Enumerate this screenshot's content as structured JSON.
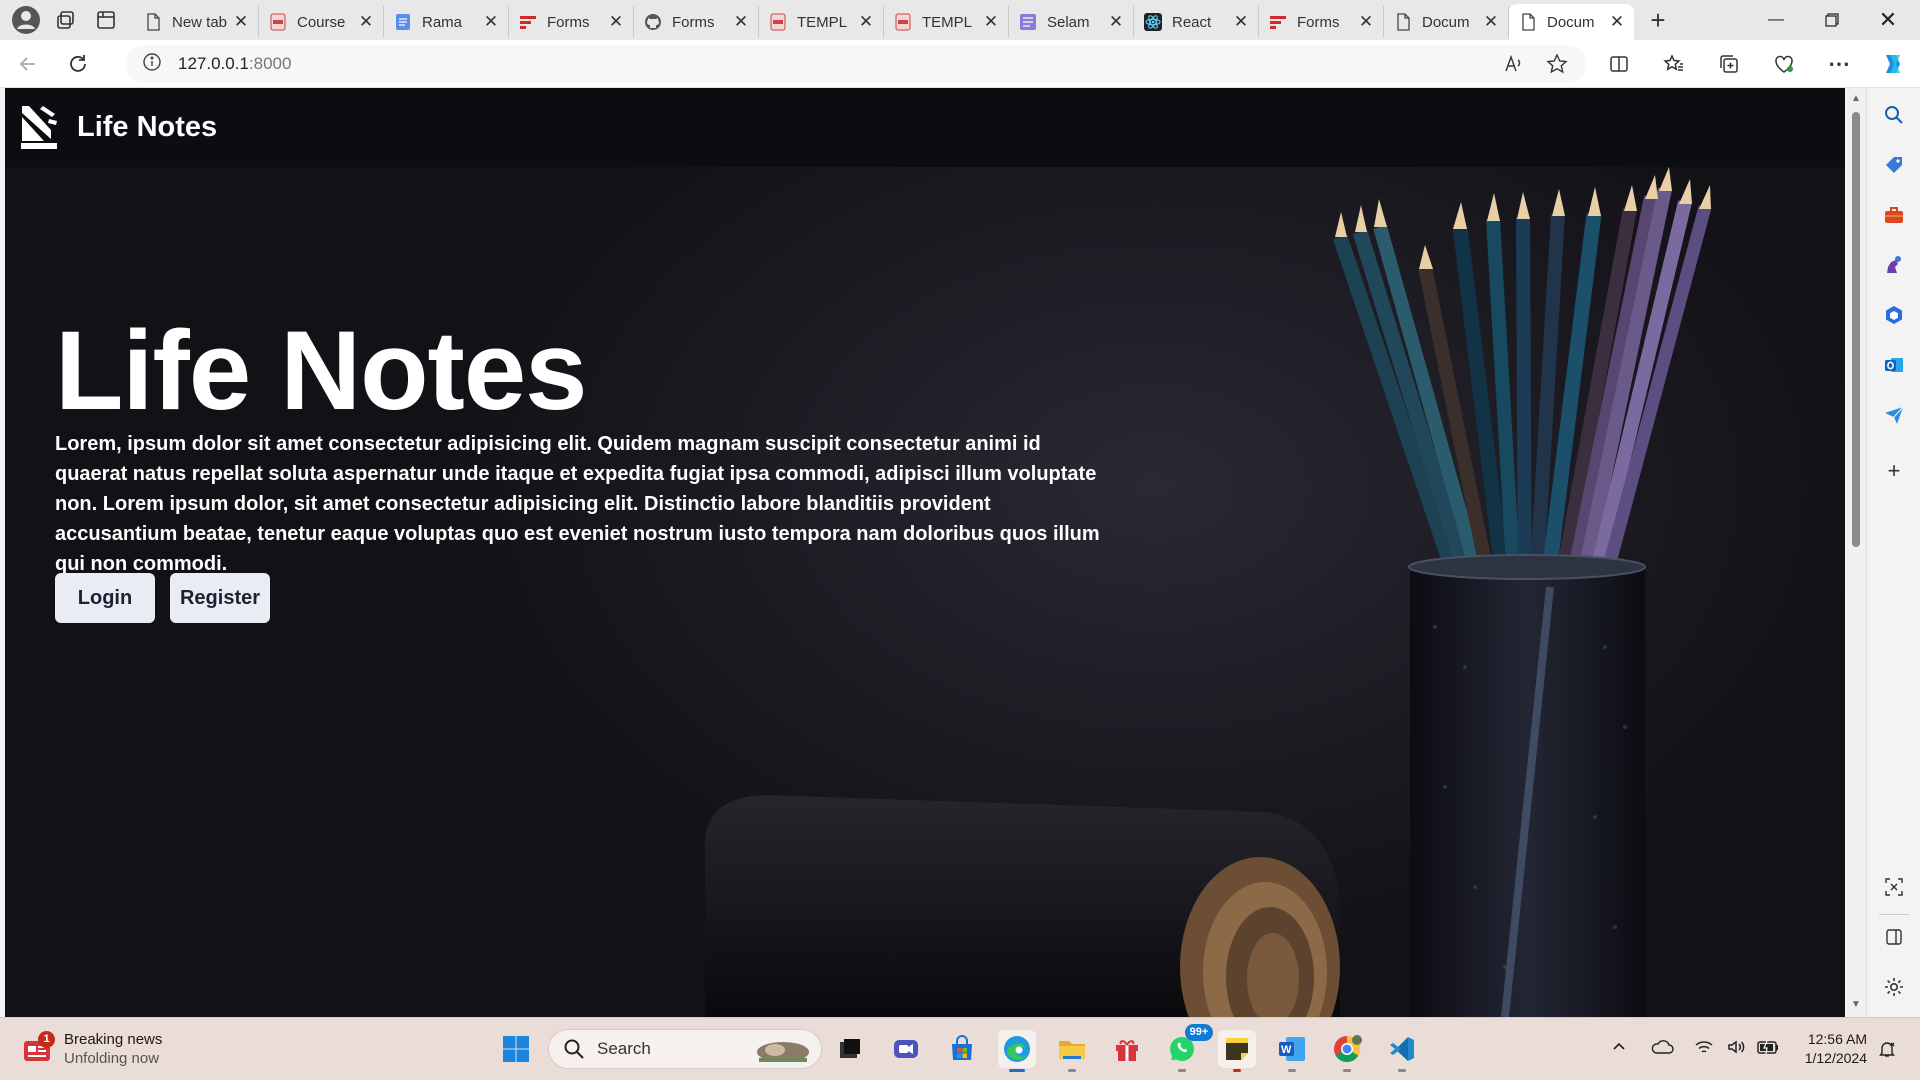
{
  "browser": {
    "tabs": [
      {
        "title": "New tab",
        "favicon": "page-icon"
      },
      {
        "title": "Course",
        "favicon": "pdf-icon"
      },
      {
        "title": "Rama",
        "favicon": "docs-icon"
      },
      {
        "title": "Forms",
        "favicon": "forms-icon"
      },
      {
        "title": "Forms",
        "favicon": "github-icon"
      },
      {
        "title": "TEMPL",
        "favicon": "pdf-icon"
      },
      {
        "title": "TEMPL",
        "favicon": "pdf-icon"
      },
      {
        "title": "Selam",
        "favicon": "notes-icon"
      },
      {
        "title": "React",
        "favicon": "react-icon"
      },
      {
        "title": "Forms",
        "favicon": "forms-icon"
      },
      {
        "title": "Docum",
        "favicon": "page-icon"
      },
      {
        "title": "Docum",
        "favicon": "page-icon",
        "active": true
      }
    ],
    "url_host": "127.0.0.1",
    "url_port": ":8000"
  },
  "site": {
    "brand": "Life Notes",
    "hero_title": "Life Notes",
    "hero_text": "Lorem, ipsum dolor sit amet consectetur adipisicing elit. Quidem magnam suscipit consectetur animi id quaerat natus repellat soluta aspernatur unde itaque et expedita fugiat ipsa commodi, adipisci illum voluptate non. Lorem ipsum dolor, sit amet consectetur adipisicing elit. Distinctio labore blanditiis provident accusantium beatae, tenetur eaque voluptas quo est eveniet nostrum iusto tempora nam doloribus quos illum qui non commodi.",
    "login_label": "Login",
    "register_label": "Register"
  },
  "taskbar": {
    "news_title": "Breaking news",
    "news_sub": "Unfolding now",
    "news_badge": "1",
    "search_label": "Search",
    "whatsapp_badge": "99+",
    "time": "12:56 AM",
    "date": "1/12/2024"
  },
  "colors": {
    "page_bg": "#121116",
    "nav_bg": "#0d0c11",
    "button_bg": "#e9ecf2",
    "taskbar_bg": "#eadcd6"
  }
}
